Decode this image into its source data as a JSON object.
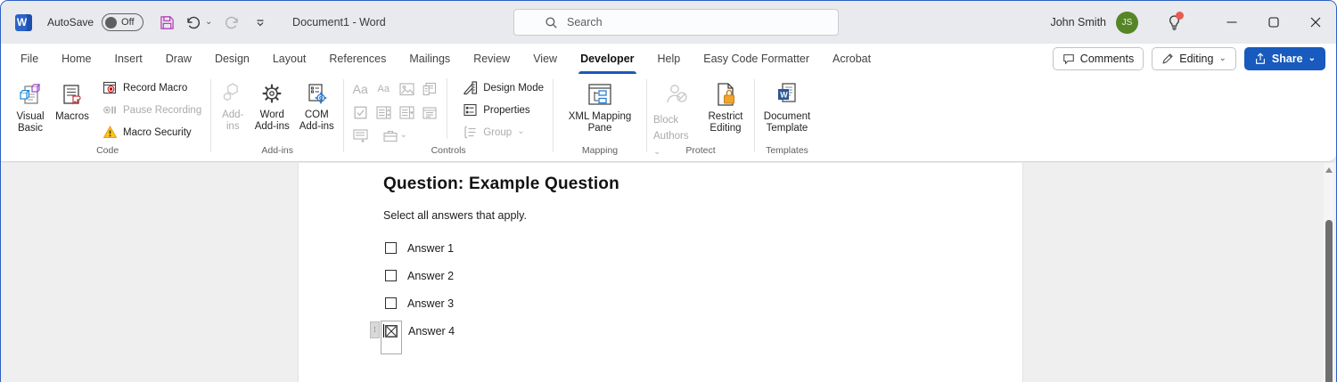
{
  "colors": {
    "accent_blue": "#185abd",
    "titlebar_bg": "#e8eaed",
    "canvas_bg": "#efefef",
    "avatar_green": "#568527",
    "alert_red": "#e85b52",
    "save_magenta": "#b83fb8",
    "record_red": "#d13438",
    "warning_orange": "#f0a30a",
    "lock_orange": "#f0a52f",
    "mapping_blue": "#2b7cd3",
    "disabled_gray": "#ababab"
  },
  "titlebar": {
    "autosave_label": "AutoSave",
    "autosave_state": "Off",
    "document_title": "Document1 - Word",
    "search_placeholder": "Search",
    "user_name": "John Smith",
    "user_initials": "JS"
  },
  "menubar": {
    "tabs": [
      "File",
      "Home",
      "Insert",
      "Draw",
      "Design",
      "Layout",
      "References",
      "Mailings",
      "Review",
      "View",
      "Developer",
      "Help",
      "Easy Code Formatter",
      "Acrobat"
    ],
    "active_tab": "Developer",
    "comments": "Comments",
    "editing": "Editing",
    "share": "Share"
  },
  "ribbon": {
    "code": {
      "label": "Code",
      "visual_basic": "Visual Basic",
      "macros": "Macros",
      "record_macro": "Record Macro",
      "pause_recording": "Pause Recording",
      "macro_security": "Macro Security"
    },
    "addins": {
      "label": "Add-ins",
      "addins": "Add-ins",
      "word_addins": "Word Add-ins",
      "com_addins": "COM Add-ins"
    },
    "controls": {
      "label": "Controls",
      "design_mode": "Design Mode",
      "properties": "Properties",
      "group": "Group"
    },
    "mapping": {
      "label": "Mapping",
      "xml_mapping_pane": "XML Mapping Pane"
    },
    "protect": {
      "label": "Protect",
      "block_authors": "Block Authors",
      "restrict_editing": "Restrict Editing"
    },
    "templates": {
      "label": "Templates",
      "document_template": "Document Template"
    }
  },
  "document": {
    "heading": "Question: Example Question",
    "instruction": "Select all answers that apply.",
    "answers": [
      {
        "label": "Answer 1",
        "checked": false
      },
      {
        "label": "Answer 2",
        "checked": false
      },
      {
        "label": "Answer 3",
        "checked": false
      },
      {
        "label": "Answer 4",
        "checked": true
      }
    ]
  },
  "icons": {
    "chevron_down": "⌄",
    "drag_handle_dots": "⁞",
    "undo": "↺",
    "redo": "↻"
  }
}
